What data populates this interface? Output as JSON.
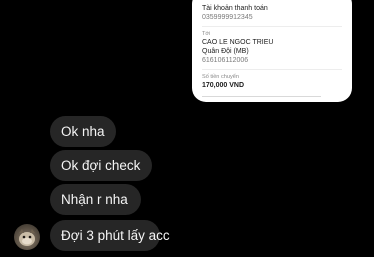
{
  "receipt": {
    "account_label": "Tài khoản thanh toán",
    "account_number": "0359999912345",
    "to_label": "Tới",
    "recipient_name": "CAO LE NGOC TRIEU",
    "recipient_bank": "Quân Đội (MB)",
    "recipient_account": "616106112006",
    "amount_label": "Số tiền chuyển",
    "amount": "170,000 VND"
  },
  "messages": [
    {
      "text": "Ok nha"
    },
    {
      "text": "Ok đợi check"
    },
    {
      "text": "Nhận r nha"
    },
    {
      "text": "Đợi 3 phút lấy acc"
    }
  ],
  "avatar_icon": "sender-avatar"
}
